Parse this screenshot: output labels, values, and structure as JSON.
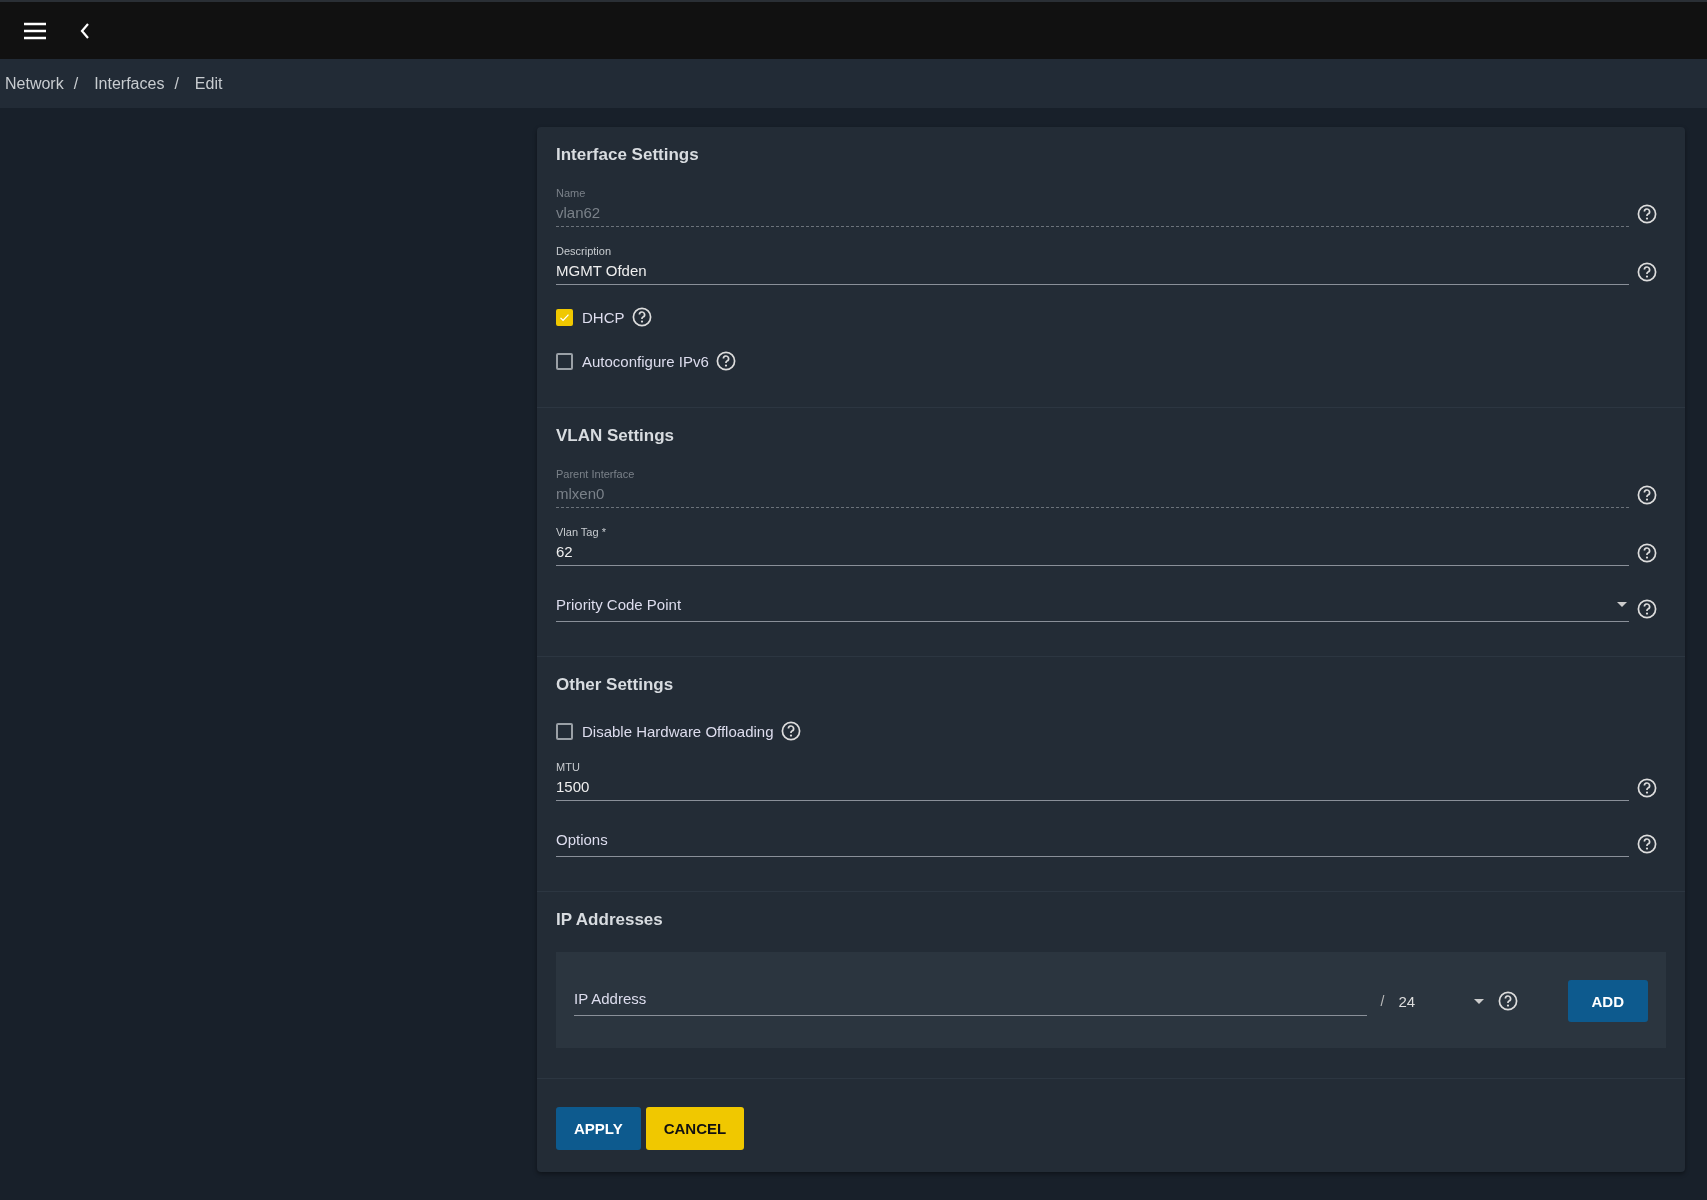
{
  "breadcrumb": [
    "Network",
    "Interfaces",
    "Edit"
  ],
  "breadcrumb_separator": "/",
  "sections": [
    {
      "title": "Interface Settings",
      "fields": [
        {
          "kind": "text",
          "label": "Name",
          "value": "vlan62",
          "disabled": true
        },
        {
          "kind": "text",
          "label": "Description",
          "value": "MGMT Ofden",
          "disabled": false
        },
        {
          "kind": "checkbox",
          "label": "DHCP",
          "checked": true
        },
        {
          "kind": "checkbox",
          "label": "Autoconfigure IPv6",
          "checked": false
        }
      ]
    },
    {
      "title": "VLAN Settings",
      "fields": [
        {
          "kind": "text",
          "label": "Parent Interface",
          "value": "mlxen0",
          "disabled": true
        },
        {
          "kind": "text",
          "label": "Vlan Tag *",
          "value": "62",
          "disabled": false
        },
        {
          "kind": "select",
          "placeholder": "Priority Code Point"
        }
      ]
    },
    {
      "title": "Other Settings",
      "fields": [
        {
          "kind": "checkbox",
          "label": "Disable Hardware Offloading",
          "checked": false
        },
        {
          "kind": "text",
          "label": "MTU",
          "value": "1500",
          "disabled": false
        },
        {
          "kind": "input",
          "placeholder": "Options"
        }
      ]
    },
    {
      "title": "IP Addresses",
      "fields": [
        {
          "kind": "ip",
          "placeholder": "IP Address",
          "separator": "/",
          "netmask": "24",
          "button": "ADD"
        }
      ]
    }
  ],
  "buttons": [
    {
      "label": "APPLY",
      "kind": "primary"
    },
    {
      "label": "CANCEL",
      "kind": "warn"
    }
  ]
}
